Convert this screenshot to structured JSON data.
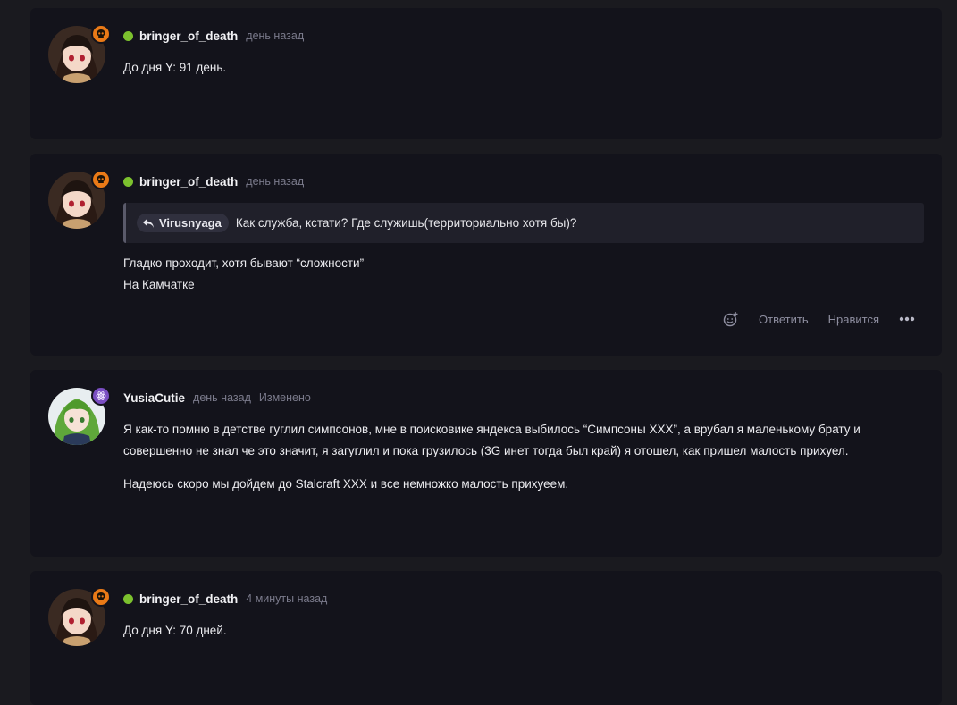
{
  "posts": [
    {
      "username": "bringer_of_death",
      "time": "день назад",
      "paragraphs": [
        "До дня Y: 91 день."
      ],
      "badge_icon": "skull-icon",
      "avatar_icon": "anime-girl-avatar"
    },
    {
      "username": "bringer_of_death",
      "time": "день назад",
      "quote": {
        "author": "Virusnyaga",
        "text": "Как служба, кстати? Где служишь(территориально хотя бы)?",
        "icon": "reply-arrow-icon"
      },
      "paragraphs": [
        "Гладко проходит, хотя бывают “сложности”",
        "На Камчатке"
      ],
      "actions": {
        "react_icon": "add-reaction-icon",
        "reply_label": "Ответить",
        "like_label": "Нравится",
        "more_icon": "more-dots-icon"
      }
    },
    {
      "username": "YusiaCutie",
      "time": "день назад",
      "edited": "Изменено",
      "paragraphs": [
        "Я как-то помню в детстве гуглил симпсонов, мне в поисковике яндекса выбилось “Симпсоны XXX”, а врубал я маленькому брату и совершенно не знал че это значит, я загуглил и пока грузилось (3G инет тогда был край) я отошел, как пришел малость прихуел.",
        "Надеюсь скоро мы дойдем до Stalcraft XXX и все немножко малость прихуеем."
      ],
      "badge_icon": "atom-icon"
    },
    {
      "username": "bringer_of_death",
      "time": "4 минуты назад",
      "paragraphs": [
        "До дня Y: 70 дней."
      ],
      "badge_icon": "skull-icon"
    }
  ],
  "colors": {
    "background": "#1a1a1f",
    "card": "#13131b",
    "online": "#7cc12e",
    "skull_badge": "#ea7a17",
    "atom_badge": "#7a4ec2",
    "muted_text": "#7b7b8c"
  }
}
